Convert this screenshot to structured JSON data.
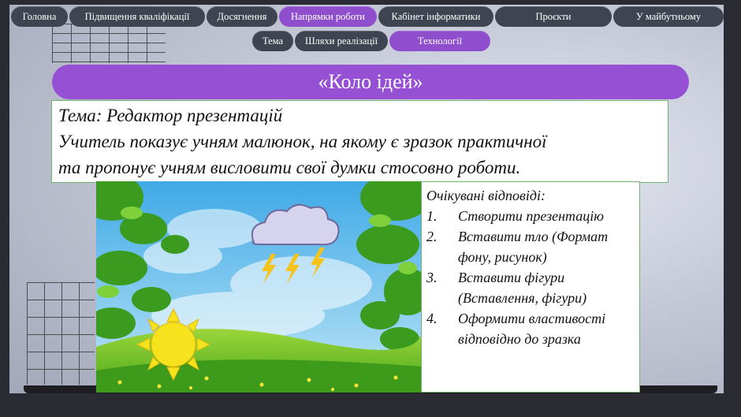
{
  "nav": {
    "tabs": [
      {
        "id": "home",
        "label": "Головна",
        "active": false
      },
      {
        "id": "qualification",
        "label": "Підвищення кваліфікації",
        "active": false
      },
      {
        "id": "achievements",
        "label": "Досягнення",
        "active": false
      },
      {
        "id": "directions",
        "label": "Напрямки  роботи",
        "active": true
      },
      {
        "id": "cabinet",
        "label": "Кабінет інформатики",
        "active": false
      },
      {
        "id": "projects",
        "label": "Проєкти",
        "active": false
      },
      {
        "id": "future",
        "label": "У майбутньому",
        "active": false
      }
    ]
  },
  "subnav": {
    "tabs": [
      {
        "id": "topic",
        "label": "Тема",
        "active": false
      },
      {
        "id": "ways",
        "label": "Шляхи реалізації",
        "active": false
      },
      {
        "id": "tech",
        "label": "Технології",
        "active": true
      }
    ]
  },
  "banner": {
    "title": "«Коло ідей»"
  },
  "theme": {
    "line1": "Тема: Редактор презентацій",
    "line2": "Учитель показує учням малюнок, на якому є зразок практичної",
    "line3": "та пропонує учням висловити свої думки стосовно роботи."
  },
  "answers": {
    "title": "Очікувані відповіді:",
    "items": [
      {
        "num": "1.",
        "text": "Створити презентацію"
      },
      {
        "num": "2.",
        "text": "Вставити тло (Формат фону, рисунок)"
      },
      {
        "num": "3.",
        "text": "Вставити фігури (Вставлення, фігури)"
      },
      {
        "num": "4.",
        "text": " Оформити властивості відповідно до зразка"
      }
    ]
  },
  "colors": {
    "accent": "#9650d3",
    "tab": "#3e4450",
    "border": "#6fb36f"
  },
  "picture": {
    "icons": [
      "cloud-icon",
      "lightning-icon",
      "sun-icon",
      "leaves-icon",
      "meadow-icon"
    ]
  }
}
